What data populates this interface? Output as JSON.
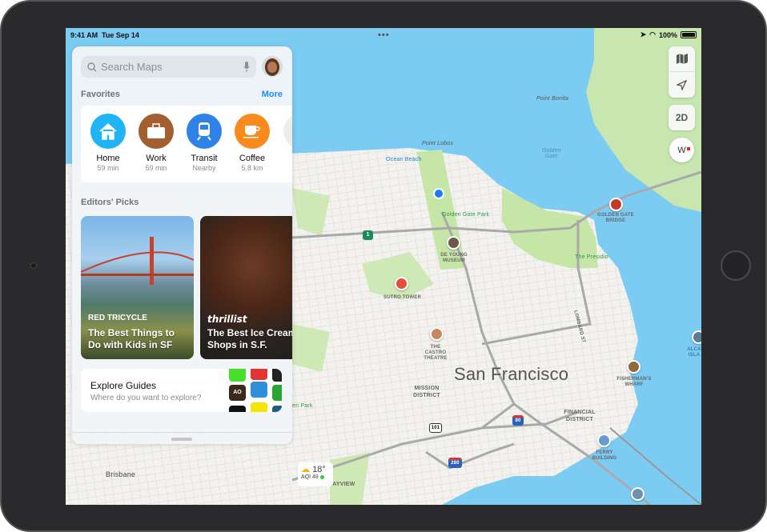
{
  "status_bar": {
    "time": "9:41 AM",
    "date": "Tue Sep 14",
    "battery": "100%",
    "battery_level": 1.0
  },
  "panel": {
    "search_placeholder": "Search Maps",
    "favorites_title": "Favorites",
    "more_label": "More",
    "favorites": [
      {
        "label": "Home",
        "sub": "59 min",
        "icon": "house-icon",
        "color": "#1fb4f5"
      },
      {
        "label": "Work",
        "sub": "59 min",
        "icon": "briefcase-icon",
        "color": "#a45f31"
      },
      {
        "label": "Transit",
        "sub": "Nearby",
        "icon": "tram-icon",
        "color": "#2f83e8"
      },
      {
        "label": "Coffee",
        "sub": "5.8 km",
        "icon": "coffee-cup-icon",
        "color": "#fb8a1d"
      }
    ],
    "editors_title": "Editors' Picks",
    "picks": [
      {
        "brand": "RED TRICYCLE",
        "title_line1": "The Best Things to",
        "title_line2": "Do with Kids in SF"
      },
      {
        "brand": "thrillist",
        "title_line1": "The Best Ice Cream",
        "title_line2": "Shops in S.F."
      }
    ],
    "guides_title": "Explore Guides",
    "guides_sub": "Where do you want to explore?",
    "guides_badge": "AO"
  },
  "controls": {
    "mode_2d": "2D",
    "compass": "W"
  },
  "weather": {
    "temp": "18°",
    "aqi": "AQI 48"
  },
  "map_labels": {
    "city": "San Francisco",
    "point_bonita": "Point Bonita",
    "point_lobos": "Point Lobos",
    "golden_gate_water": "Golden Gate",
    "ocean_beach": "Ocean Beach",
    "golden_gate_park": "Golden Gate Park",
    "presidio": "The Presidio",
    "golden_gate_bridge": "GOLDEN GATE BRIDGE",
    "de_young": "DE YOUNG MUSEUM",
    "sutro": "SUTRO TOWER",
    "castro": "THE CASTRO THEATRE",
    "mission": "MISSION DISTRICT",
    "financial": "FINANCIAL DISTRICT",
    "fishermans": "FISHERMAN'S WHARF",
    "ferry": "FERRY BUILDING",
    "alcatraz": "ALCA ISLA",
    "lombard": "LOMBARD ST",
    "brisbane": "Brisbane",
    "bayview": "BAYVIEW",
    "mclaren": "en Park",
    "hwy1": "1",
    "hwy101": "101",
    "i80": "80",
    "i280": "280"
  }
}
